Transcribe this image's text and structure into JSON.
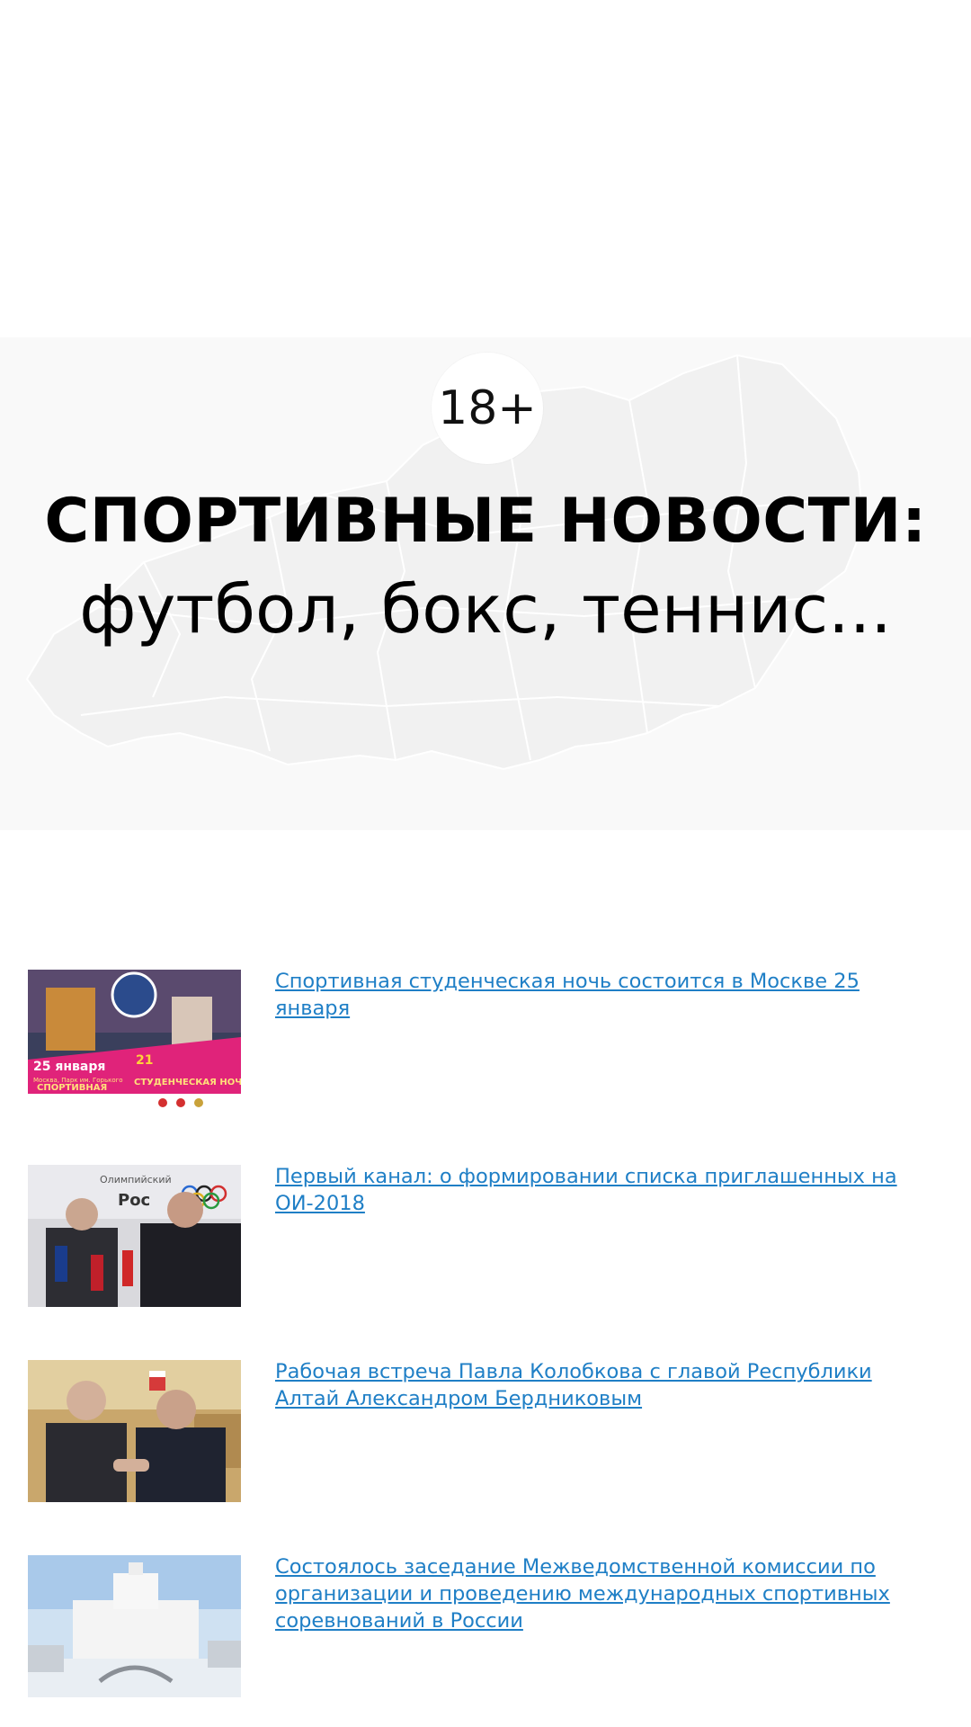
{
  "hero": {
    "age_rating": "18+",
    "title": "СПОРТИВНЫЕ НОВОСТИ:",
    "subtitle": "футбол, бокс, теннис..."
  },
  "news": [
    {
      "title": "Спортивная студенческая ночь состоится в Москве 25 января",
      "thumb_text": [
        "25 января",
        "Москва, Парк им. Горького",
        "СПОРТИВНАЯ",
        "СТУДЕНЧЕСКАЯ НОЧЬ",
        "21"
      ]
    },
    {
      "title": "Первый канал: о формировании списка приглашенных на ОИ-2018",
      "thumb_text": [
        "Олимпийский",
        "Рос"
      ]
    },
    {
      "title": "Рабочая встреча Павла Колобкова с главой Республики Алтай Александром Бердниковым",
      "thumb_text": []
    },
    {
      "title": "Состоялось заседание Межведомственной комиссии по организации и проведению международных спортивных соревнований в России",
      "thumb_text": []
    }
  ],
  "colors": {
    "link": "#1f7fc6",
    "hero_bg": "#f9f9f9",
    "map_fill": "#f0f0f0"
  }
}
